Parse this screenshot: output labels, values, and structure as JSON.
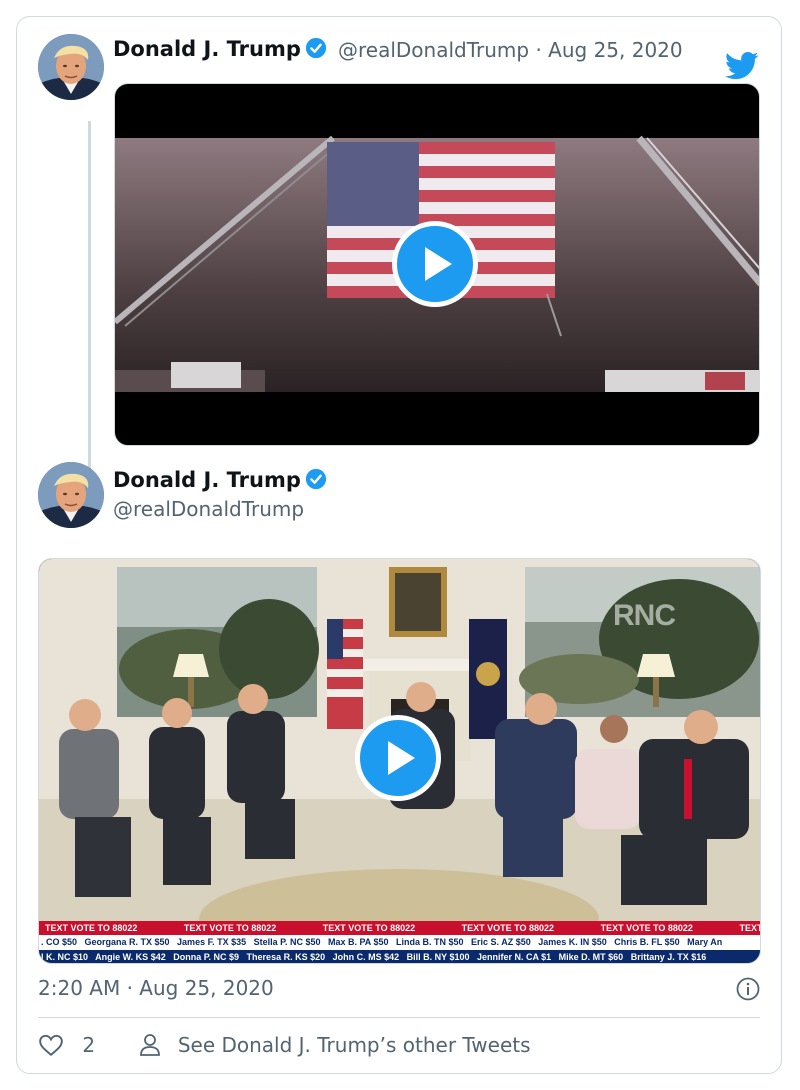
{
  "tweet1": {
    "name": "Donald J. Trump",
    "handle": "@realDonaldTrump",
    "separator": "·",
    "date": "Aug 25, 2020"
  },
  "tweet2": {
    "name": "Donald J. Trump",
    "handle": "@realDonaldTrump",
    "video_watermark": "RNC",
    "ticker_label": "TEXT VOTE TO 88022",
    "ticker_row2": ". CO $50   Georgana R. TX $50   James F. TX $35   Stella P. NC $50   Max B. PA $50   Linda B. TN $50   Eric S. AZ $50   James K. IN $50   Chris B. FL $50   Mary An",
    "ticker_row3": "l K. NC $10   Angie W. KS $42   Donna P. NC $9   Theresa R. KS $20   John C. MS $42   Bill B. NY $100   Jennifer N. CA $1   Mike D. MT $60   Brittany J. TX $16"
  },
  "footer": {
    "timestamp": "2:20 AM · Aug 25, 2020",
    "like_count": "2",
    "see_other": "See Donald J. Trump’s other Tweets"
  },
  "icons": {
    "verified": "verified-badge-icon",
    "bird": "twitter-bird-icon",
    "play": "play-icon",
    "info": "info-icon",
    "heart": "heart-icon",
    "person": "person-icon"
  },
  "colors": {
    "accent": "#1d9bf0",
    "text": "#0f1419",
    "muted": "#536471",
    "border": "#cfd9de",
    "ticker_red": "#c8102e",
    "ticker_navy": "#0a2a6b"
  }
}
